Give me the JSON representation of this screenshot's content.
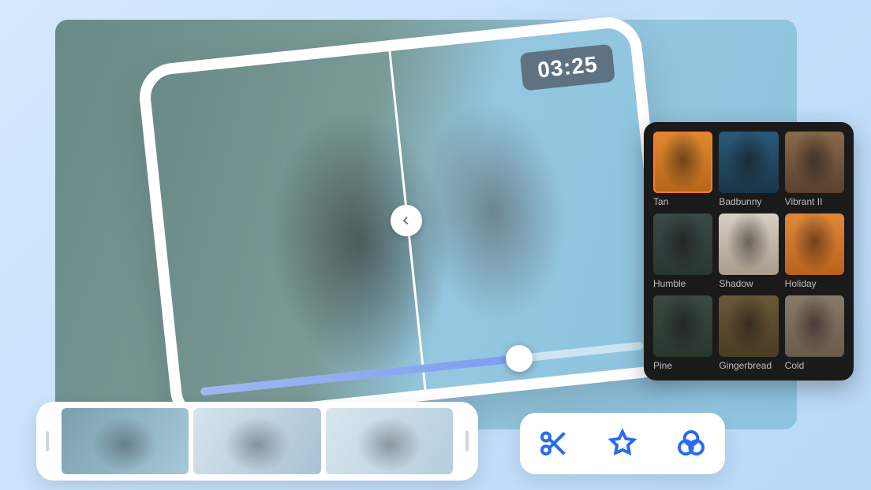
{
  "preview": {
    "timestamp": "03:25",
    "progress_percent": 72
  },
  "filters": [
    {
      "label": "Tan",
      "theme": "f-tan",
      "selected": true
    },
    {
      "label": "Badbunny",
      "theme": "f-badbunny",
      "selected": false
    },
    {
      "label": "Vibrant II",
      "theme": "f-vibrant",
      "selected": false
    },
    {
      "label": "Humble",
      "theme": "f-humble",
      "selected": false
    },
    {
      "label": "Shadow",
      "theme": "f-shadow",
      "selected": false
    },
    {
      "label": "Holiday",
      "theme": "f-holiday",
      "selected": false
    },
    {
      "label": "Pine",
      "theme": "f-pine",
      "selected": false
    },
    {
      "label": "Gingerbread",
      "theme": "f-ginger",
      "selected": false
    },
    {
      "label": "Cold",
      "theme": "f-cold",
      "selected": false
    }
  ],
  "tools": {
    "cut": "cut",
    "effects": "effects",
    "filters": "filters"
  },
  "clips": [
    "clip-1",
    "clip-2",
    "clip-3"
  ]
}
